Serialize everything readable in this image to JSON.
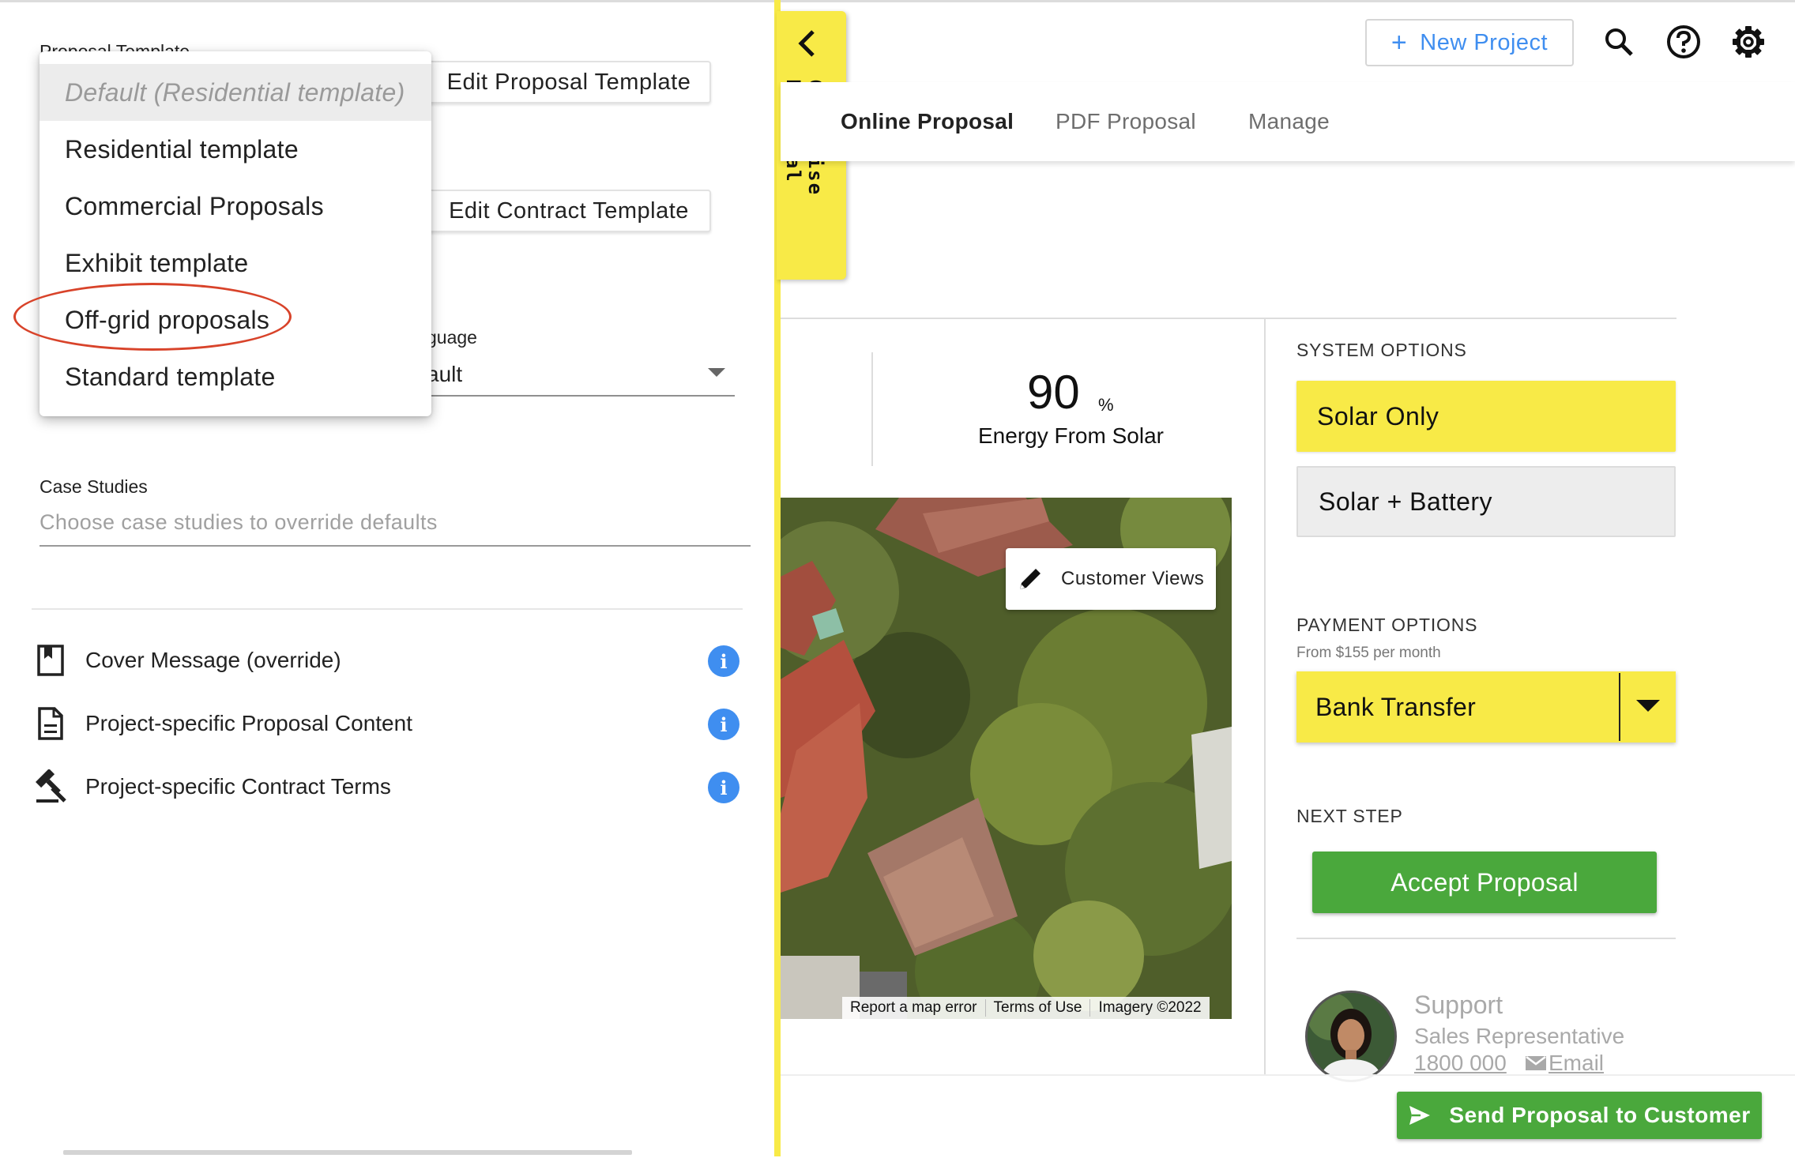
{
  "proposal_template": {
    "label": "Proposal Template",
    "edit_button": "Edit Proposal Template",
    "menu_items": [
      "Default (Residential template)",
      "Residential template",
      "Commercial Proposals",
      "Exhibit template",
      "Off-grid proposals",
      "Standard template"
    ],
    "selected_index": 0,
    "highlighted_item": "Off-grid proposals"
  },
  "contract_template": {
    "edit_button": "Edit Contract Template"
  },
  "language": {
    "label_partial": "guage",
    "value_partial": "ault"
  },
  "case_studies": {
    "label": "Case Studies",
    "placeholder": "Choose case studies to override defaults"
  },
  "left_items": [
    {
      "label": "Cover Message (override)",
      "icon": "bookmark-page-icon"
    },
    {
      "label": "Project-specific Proposal Content",
      "icon": "document-icon"
    },
    {
      "label": "Project-specific Contract Terms",
      "icon": "gavel-icon"
    }
  ],
  "customise_tab": {
    "label": "Customise Proposal"
  },
  "header": {
    "new_project_label": "New Project",
    "icons": [
      "search-icon",
      "help-icon",
      "settings-icon"
    ]
  },
  "tabs": [
    {
      "label": "Online Proposal",
      "active": true
    },
    {
      "label": "PDF Proposal",
      "active": false
    },
    {
      "label": "Manage",
      "active": false
    }
  ],
  "energy": {
    "value": "90",
    "unit": "%",
    "label": "Energy From Solar"
  },
  "map": {
    "customer_views_label": "Customer Views",
    "attribution": [
      "Report a map error",
      "Terms of Use",
      "Imagery ©2022"
    ]
  },
  "system_options": {
    "label": "SYSTEM OPTIONS",
    "options": [
      "Solar Only",
      "Solar + Battery"
    ],
    "selected": "Solar Only"
  },
  "payment_options": {
    "label": "PAYMENT OPTIONS",
    "subtitle": "From $155 per month",
    "selected": "Bank Transfer"
  },
  "next_step": {
    "label": "NEXT STEP",
    "button": "Accept Proposal"
  },
  "support": {
    "title": "Support",
    "role": "Sales Representative",
    "phone": "1800 000",
    "email": "Email"
  },
  "send_button": "Send Proposal to Customer",
  "colors": {
    "accent_yellow": "#f8ea47",
    "accent_green": "#4aa83c",
    "accent_blue": "#3f8ef0",
    "annotation_red": "#d8432a"
  }
}
